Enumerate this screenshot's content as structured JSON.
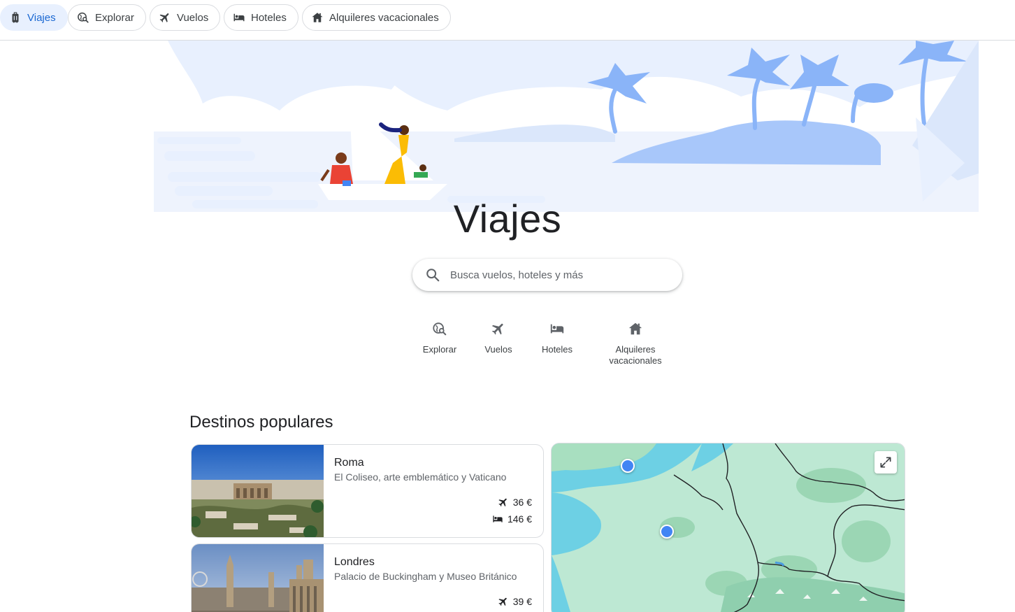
{
  "nav": {
    "chips": [
      {
        "label": "Viajes",
        "icon": "suitcase-icon",
        "active": true
      },
      {
        "label": "Explorar",
        "icon": "explore-icon",
        "active": false
      },
      {
        "label": "Vuelos",
        "icon": "airplane-icon",
        "active": false
      },
      {
        "label": "Hoteles",
        "icon": "bed-icon",
        "active": false
      },
      {
        "label": "Alquileres vacacionales",
        "icon": "house-icon",
        "active": false
      }
    ]
  },
  "page": {
    "title": "Viajes"
  },
  "search": {
    "placeholder": "Busca vuelos, hoteles y más",
    "value": ""
  },
  "quick_links": [
    {
      "label": "Explorar",
      "icon": "explore-icon"
    },
    {
      "label": "Vuelos",
      "icon": "airplane-icon"
    },
    {
      "label": "Hoteles",
      "icon": "bed-icon"
    },
    {
      "label_line1": "Alquileres",
      "label_line2": "vacacionales",
      "icon": "house-icon"
    }
  ],
  "popular": {
    "title": "Destinos populares",
    "destinations": [
      {
        "city": "Roma",
        "description": "El Coliseo, arte emblemático y Vaticano",
        "flight_price": "36 €",
        "hotel_price": "146 €"
      },
      {
        "city": "Londres",
        "description": "Palacio de Buckingham y Museo Británico",
        "flight_price": "39 €"
      }
    ]
  },
  "colors": {
    "accent": "#1967d2",
    "active_chip_bg": "#e8f0fe",
    "map_land": "#bde8d3",
    "map_water": "#6dd0e4",
    "pin": "#4285f4"
  }
}
